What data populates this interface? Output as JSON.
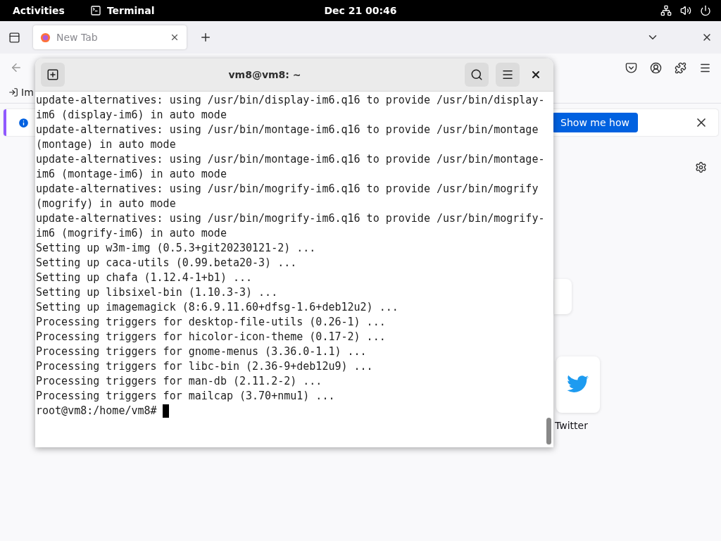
{
  "top_bar": {
    "activities": "Activities",
    "app": "Terminal",
    "clock": "Dec 21  00:46"
  },
  "browser": {
    "tabs": [
      {
        "label": "New Tab",
        "selected": true
      }
    ],
    "bookmark": "Im",
    "notification": {
      "button": "Show me how"
    },
    "shortcuts": [
      {
        "kind": "blank"
      },
      {
        "label": "Twitter",
        "kind": "twitter"
      }
    ]
  },
  "terminal": {
    "title": "vm8@vm8: ~",
    "lines": [
      "update-alternatives: using /usr/bin/display-im6.q16 to provide /usr/bin/display-",
      "im6 (display-im6) in auto mode",
      "update-alternatives: using /usr/bin/montage-im6.q16 to provide /usr/bin/montage",
      "(montage) in auto mode",
      "update-alternatives: using /usr/bin/montage-im6.q16 to provide /usr/bin/montage-",
      "im6 (montage-im6) in auto mode",
      "update-alternatives: using /usr/bin/mogrify-im6.q16 to provide /usr/bin/mogrify",
      "(mogrify) in auto mode",
      "update-alternatives: using /usr/bin/mogrify-im6.q16 to provide /usr/bin/mogrify-",
      "im6 (mogrify-im6) in auto mode",
      "Setting up w3m-img (0.5.3+git20230121-2) ...",
      "Setting up caca-utils (0.99.beta20-3) ...",
      "Setting up chafa (1.12.4-1+b1) ...",
      "Setting up libsixel-bin (1.10.3-3) ...",
      "Setting up imagemagick (8:6.9.11.60+dfsg-1.6+deb12u2) ...",
      "Processing triggers for desktop-file-utils (0.26-1) ...",
      "Processing triggers for hicolor-icon-theme (0.17-2) ...",
      "Processing triggers for gnome-menus (3.36.0-1.1) ...",
      "Processing triggers for libc-bin (2.36-9+deb12u9) ...",
      "Processing triggers for man-db (2.11.2-2) ...",
      "Processing triggers for mailcap (3.70+nmu1) ..."
    ],
    "prompt": "root@vm8:/home/vm8#"
  }
}
